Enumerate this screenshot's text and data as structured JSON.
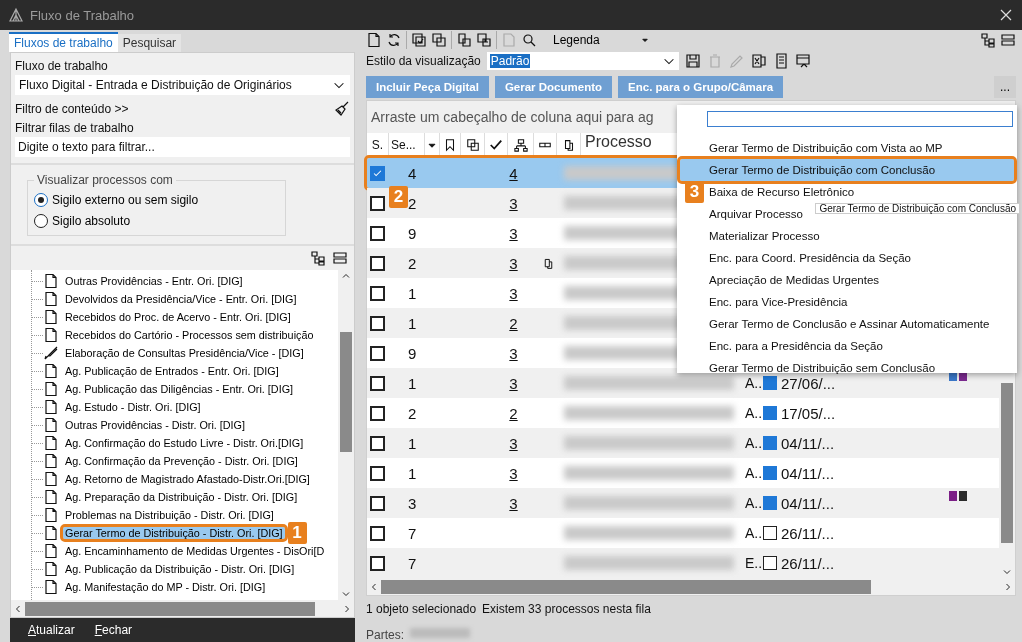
{
  "window": {
    "title": "Fluxo de Trabalho"
  },
  "left_tabs": [
    {
      "label": "Fluxos de trabalho",
      "selected": true
    },
    {
      "label": "Pesquisar",
      "selected": false
    }
  ],
  "workflow": {
    "label": "Fluxo de trabalho",
    "value": "Fluxo Digital - Entrada e Distribuição de Originários"
  },
  "content_filter": "Filtro de conteúdo >>",
  "queue_filter": {
    "label": "Filtrar filas de trabalho",
    "placeholder": "Digite o texto para filtrar..."
  },
  "visibility": {
    "legend": "Visualizar processos com",
    "options": [
      {
        "label": "Sigilo externo ou sem sigilo",
        "selected": true
      },
      {
        "label": "Sigilo absoluto",
        "selected": false
      }
    ]
  },
  "queues": [
    {
      "label": "Outras Providências - Entr. Ori. [DIG]",
      "kind": "doc",
      "selected": false
    },
    {
      "label": "Devolvidos da Presidência/Vice - Entr. Ori. [DIG]",
      "kind": "doc",
      "selected": false
    },
    {
      "label": "Recebidos do Proc. de Acervo - Entr. Ori. [DIG]",
      "kind": "doc",
      "selected": false
    },
    {
      "label": "Recebidos do Cartório - Processos sem distribuição",
      "kind": "doc",
      "selected": false
    },
    {
      "label": "Elaboração de Consultas Presidência/Vice - [DIG]",
      "kind": "pen",
      "selected": false
    },
    {
      "label": "Ag. Publicação de Entrados - Entr. Ori. [DIG]",
      "kind": "doc",
      "selected": false
    },
    {
      "label": "Ag. Publicação das Diligências - Entr. Ori. [DIG]",
      "kind": "doc",
      "selected": false
    },
    {
      "label": "Ag. Estudo - Distr. Ori. [DIG]",
      "kind": "doc",
      "selected": false
    },
    {
      "label": "Outras Providências - Distr. Ori. [DIG]",
      "kind": "doc",
      "selected": false
    },
    {
      "label": "Ag. Confirmação do Estudo Livre - Distr. Ori.[DIG]",
      "kind": "doc",
      "selected": false
    },
    {
      "label": "Ag. Confirmação da Prevenção - Distr. Ori. [DIG]",
      "kind": "doc",
      "selected": false
    },
    {
      "label": "Ag. Retorno de Magistrado Afastado-Distr.Ori.[DIG]",
      "kind": "doc",
      "selected": false
    },
    {
      "label": "Ag. Preparação da Distribuição - Distr. Ori. [DIG]",
      "kind": "doc",
      "selected": false
    },
    {
      "label": "Problemas na Distribuição - Distr. Ori. [DIG]",
      "kind": "doc",
      "selected": false
    },
    {
      "label": "Gerar Termo de Distribuição - Distr. Ori. [DIG]",
      "kind": "doc",
      "selected": true,
      "callout": "1"
    },
    {
      "label": "Ag. Encaminhamento de Medidas Urgentes - DisOri[D",
      "kind": "doc",
      "selected": false
    },
    {
      "label": "Ag. Publicação da Distribuição - Distr. Ori. [DIG]",
      "kind": "doc",
      "selected": false
    },
    {
      "label": "Ag. Manifestação do MP - Distr. Ori. [DIG]",
      "kind": "doc",
      "selected": false
    }
  ],
  "footer_buttons": [
    "Atualizar",
    "Fechar"
  ],
  "toolbar": {
    "legend": "Legenda"
  },
  "view_style": {
    "label": "Estilo da visualização",
    "value": "Padrão"
  },
  "action_buttons": [
    "Incluir Peça Digital",
    "Gerar Documento",
    "Enc. para o Grupo/Câmara"
  ],
  "more_button": "...",
  "grid": {
    "group_hint": "Arraste um cabeçalho de coluna aqui para ag",
    "columns": [
      "S.",
      "Se...",
      "Processo"
    ],
    "rows": [
      {
        "seq": "4",
        "link": "4",
        "checked": true,
        "selected": true,
        "attachment": false,
        "callout": "2"
      },
      {
        "seq": "2",
        "link": "3",
        "checked": false,
        "selected": false,
        "attachment": false
      },
      {
        "seq": "9",
        "link": "3",
        "checked": false,
        "selected": false,
        "attachment": false
      },
      {
        "seq": "2",
        "link": "3",
        "checked": false,
        "selected": false,
        "attachment": true
      },
      {
        "seq": "1",
        "link": "3",
        "checked": false,
        "selected": false,
        "attachment": false
      },
      {
        "seq": "1",
        "link": "2",
        "checked": false,
        "selected": false,
        "attachment": false
      },
      {
        "seq": "9",
        "link": "3",
        "checked": false,
        "selected": false,
        "attachment": false
      },
      {
        "seq": "1",
        "link": "3",
        "checked": false,
        "selected": false,
        "attachment": false,
        "status": "A..",
        "flag": true,
        "date": "27/06/...",
        "tags": [
          {
            "color": "#3a78c9"
          },
          {
            "color": "#7b2a8f"
          }
        ]
      },
      {
        "seq": "2",
        "link": "2",
        "checked": false,
        "selected": false,
        "attachment": false,
        "status": "A..",
        "flag": true,
        "date": "17/05/..."
      },
      {
        "seq": "1",
        "link": "3",
        "checked": false,
        "selected": false,
        "attachment": false,
        "status": "A..",
        "flag": true,
        "date": "04/11/..."
      },
      {
        "seq": "1",
        "link": "3",
        "checked": false,
        "selected": false,
        "attachment": false,
        "status": "A..",
        "flag": true,
        "date": "04/11/..."
      },
      {
        "seq": "3",
        "link": "3",
        "checked": false,
        "selected": false,
        "attachment": false,
        "status": "A..",
        "flag": true,
        "date": "04/11/...",
        "tags": [
          {
            "color": "#7b1f86"
          },
          {
            "color": "#2b2b2b"
          }
        ]
      },
      {
        "seq": "7",
        "checked": false,
        "selected": false,
        "attachment": false,
        "status": "A..",
        "flag": false,
        "date": "26/11/..."
      },
      {
        "seq": "7",
        "checked": false,
        "selected": false,
        "attachment": false,
        "status": "E..",
        "flag": false,
        "date": "26/11/..."
      }
    ]
  },
  "status": {
    "selection": "1 objeto selecionado",
    "count": "Existem 33 processos nesta fila"
  },
  "details_label": "Partes:",
  "menu": {
    "items": [
      {
        "label": "Gerar Termo de Distribuição com Vista ao MP",
        "selected": false
      },
      {
        "label": "Gerar Termo de Distribuição com Conclusão",
        "selected": true,
        "callout": "3"
      },
      {
        "label": "Baixa de Recurso Eletrônico",
        "selected": false
      },
      {
        "label": "Arquivar Processo",
        "selected": false
      },
      {
        "label": "Materializar Processo",
        "selected": false
      },
      {
        "label": "Enc. para Coord. Presidência da Seção",
        "selected": false
      },
      {
        "label": "Apreciação de Medidas Urgentes",
        "selected": false
      },
      {
        "label": "Enc. para Vice-Presidência",
        "selected": false
      },
      {
        "label": "Gerar Termo de Conclusão e Assinar Automaticamente",
        "selected": false
      },
      {
        "label": "Enc. para a Presidência da Seção",
        "selected": false
      },
      {
        "label": "Gerar Termo de Distribuição sem Conclusão",
        "selected": false
      }
    ]
  },
  "tooltip": "Gerar Termo de Distribuição com Conclusão"
}
